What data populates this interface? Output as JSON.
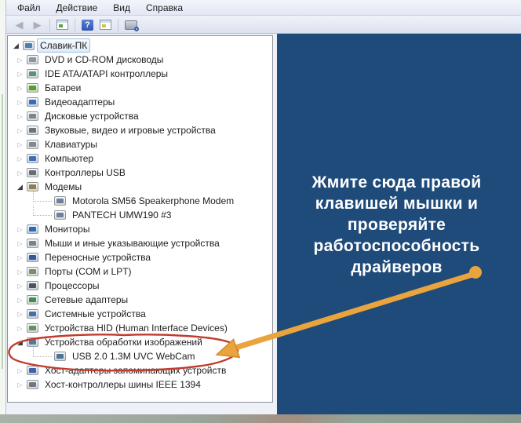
{
  "menu": {
    "items": [
      {
        "name": "menu-item-file",
        "label": "Файл"
      },
      {
        "name": "menu-item-action",
        "label": "Действие"
      },
      {
        "name": "menu-item-view",
        "label": "Вид"
      },
      {
        "name": "menu-item-help",
        "label": "Справка"
      }
    ]
  },
  "toolbar": {
    "icons": [
      {
        "name": "back-button",
        "icon": "back-arrow-icon",
        "kind": "arrow",
        "glyph": "◀"
      },
      {
        "name": "forward-button",
        "icon": "forward-arrow-icon",
        "kind": "arrow",
        "glyph": "▶"
      },
      {
        "kind": "separator"
      },
      {
        "name": "show-console-tree-button",
        "icon": "console-tree-icon",
        "kind": "panel",
        "accent": "#58a83c"
      },
      {
        "kind": "separator"
      },
      {
        "name": "help-button",
        "icon": "help-icon",
        "kind": "help",
        "glyph": "?"
      },
      {
        "name": "properties-button",
        "icon": "properties-icon",
        "kind": "panel",
        "accent": "#e0c040"
      },
      {
        "kind": "separator"
      },
      {
        "name": "scan-hardware-button",
        "icon": "scan-hardware-changes-icon",
        "kind": "scan"
      }
    ]
  },
  "tree": {
    "expanded_glyph": "◢",
    "collapsed_glyph": "▷",
    "items": [
      {
        "name": "tree-item-computer-root",
        "label": "Славик-ПК",
        "level": 0,
        "state": "expanded",
        "icon": "computer-icon",
        "icon_color": "#c9d6e4",
        "accent": "#4f7dae",
        "selected": true
      },
      {
        "name": "tree-item-dvd-cdrom",
        "label": "DVD и CD-ROM дисководы",
        "level": 1,
        "state": "collapsed",
        "icon": "cd-drive-icon",
        "icon_color": "#cfd3d8",
        "accent": "#8e959d"
      },
      {
        "name": "tree-item-ide-ata",
        "label": "IDE ATA/ATAPI контроллеры",
        "level": 1,
        "state": "collapsed",
        "icon": "ide-controller-icon",
        "icon_color": "#c8d6d2",
        "accent": "#5f8f7f"
      },
      {
        "name": "tree-item-batteries",
        "label": "Батареи",
        "level": 1,
        "state": "collapsed",
        "icon": "battery-icon",
        "icon_color": "#bcd9a0",
        "accent": "#5a9a2e"
      },
      {
        "name": "tree-item-video-adapters",
        "label": "Видеоадаптеры",
        "level": 1,
        "state": "collapsed",
        "icon": "display-adapter-icon",
        "icon_color": "#b9cce6",
        "accent": "#3c6cb0"
      },
      {
        "name": "tree-item-disk-devices",
        "label": "Дисковые устройства",
        "level": 1,
        "state": "collapsed",
        "icon": "disk-drive-icon",
        "icon_color": "#d2d6db",
        "accent": "#7d858e"
      },
      {
        "name": "tree-item-sound-video-game",
        "label": "Звуковые, видео и игровые устройства",
        "level": 1,
        "state": "collapsed",
        "icon": "audio-device-icon",
        "icon_color": "#d5d8dc",
        "accent": "#6d737b"
      },
      {
        "name": "tree-item-keyboards",
        "label": "Клавиатуры",
        "level": 1,
        "state": "collapsed",
        "icon": "keyboard-icon",
        "icon_color": "#d8dbdf",
        "accent": "#83898f"
      },
      {
        "name": "tree-item-computer",
        "label": "Компьютер",
        "level": 1,
        "state": "collapsed",
        "icon": "computer-icon",
        "icon_color": "#bfd2e8",
        "accent": "#3f6fae"
      },
      {
        "name": "tree-item-usb-controllers",
        "label": "Контроллеры USB",
        "level": 1,
        "state": "collapsed",
        "icon": "usb-controller-icon",
        "icon_color": "#d0d4d9",
        "accent": "#666c74"
      },
      {
        "name": "tree-item-modems",
        "label": "Модемы",
        "level": 1,
        "state": "expanded",
        "icon": "modem-icon",
        "icon_color": "#d9d3be",
        "accent": "#8c7f54"
      },
      {
        "name": "tree-item-motorola-modem",
        "label": "Motorola SM56 Speakerphone Modem",
        "level": 2,
        "state": "none",
        "icon": "modem-device-icon",
        "icon_color": "#d9dcc9",
        "accent": "#6f7f9f"
      },
      {
        "name": "tree-item-pantech-modem",
        "label": "PANTECH UMW190 #3",
        "level": 2,
        "state": "none",
        "icon": "modem-device-icon",
        "icon_color": "#d9dcc9",
        "accent": "#6f7f9f"
      },
      {
        "name": "tree-item-monitors",
        "label": "Мониторы",
        "level": 1,
        "state": "collapsed",
        "icon": "monitor-icon",
        "icon_color": "#b9d0ea",
        "accent": "#2f6ab2"
      },
      {
        "name": "tree-item-mice",
        "label": "Мыши и иные указывающие устройства",
        "level": 1,
        "state": "collapsed",
        "icon": "mouse-icon",
        "icon_color": "#d6d9dd",
        "accent": "#7b8289"
      },
      {
        "name": "tree-item-portable-devices",
        "label": "Переносные устройства",
        "level": 1,
        "state": "collapsed",
        "icon": "portable-device-icon",
        "icon_color": "#b9c6dd",
        "accent": "#35589a"
      },
      {
        "name": "tree-item-ports",
        "label": "Порты (COM и LPT)",
        "level": 1,
        "state": "collapsed",
        "icon": "serial-port-icon",
        "icon_color": "#d4d7d2",
        "accent": "#7f8a6f"
      },
      {
        "name": "tree-item-processors",
        "label": "Процессоры",
        "level": 1,
        "state": "collapsed",
        "icon": "processor-icon",
        "icon_color": "#c6cbd2",
        "accent": "#4a5360"
      },
      {
        "name": "tree-item-network-adapters",
        "label": "Сетевые адаптеры",
        "level": 1,
        "state": "collapsed",
        "icon": "network-adapter-icon",
        "icon_color": "#ccd5cf",
        "accent": "#3e8f4e"
      },
      {
        "name": "tree-item-system-devices",
        "label": "Системные устройства",
        "level": 1,
        "state": "collapsed",
        "icon": "system-device-icon",
        "icon_color": "#c3d0e2",
        "accent": "#4a6fa5"
      },
      {
        "name": "tree-item-hid-devices",
        "label": "Устройства HID (Human Interface Devices)",
        "level": 1,
        "state": "collapsed",
        "icon": "hid-device-icon",
        "icon_color": "#cdd5cc",
        "accent": "#6a8f5f"
      },
      {
        "name": "tree-item-imaging-devices",
        "label": "Устройства обработки изображений",
        "level": 1,
        "state": "expanded",
        "icon": "imaging-device-icon",
        "icon_color": "#c7d2dc",
        "accent": "#55789a"
      },
      {
        "name": "tree-item-usb-webcam",
        "label": "USB 2.0 1.3M UVC WebCam",
        "level": 2,
        "state": "none",
        "icon": "webcam-icon",
        "icon_color": "#c9d3de",
        "accent": "#4f7496"
      },
      {
        "name": "tree-item-storage-host-adapters",
        "label": "Хост-адаптеры запоминающих устройств",
        "level": 1,
        "state": "collapsed",
        "icon": "storage-adapter-icon",
        "icon_color": "#bcc9e0",
        "accent": "#3d62a8"
      },
      {
        "name": "tree-item-ieee1394-controllers",
        "label": "Хост-контроллеры шины IEEE 1394",
        "level": 1,
        "state": "collapsed",
        "icon": "firewire-icon",
        "icon_color": "#d1d4d9",
        "accent": "#70767e"
      }
    ]
  },
  "annotation": {
    "lines": [
      "Жмите сюда правой",
      "клавишей мышки и",
      "проверяйте",
      "работоспособность",
      "драйверов"
    ],
    "panel_color": "#1f4b7b",
    "text_color": "#ffffff",
    "arrow_color": "#e9a43d",
    "arrow_outline": "#cf8b2b",
    "circle_color": "#c23b2c"
  }
}
